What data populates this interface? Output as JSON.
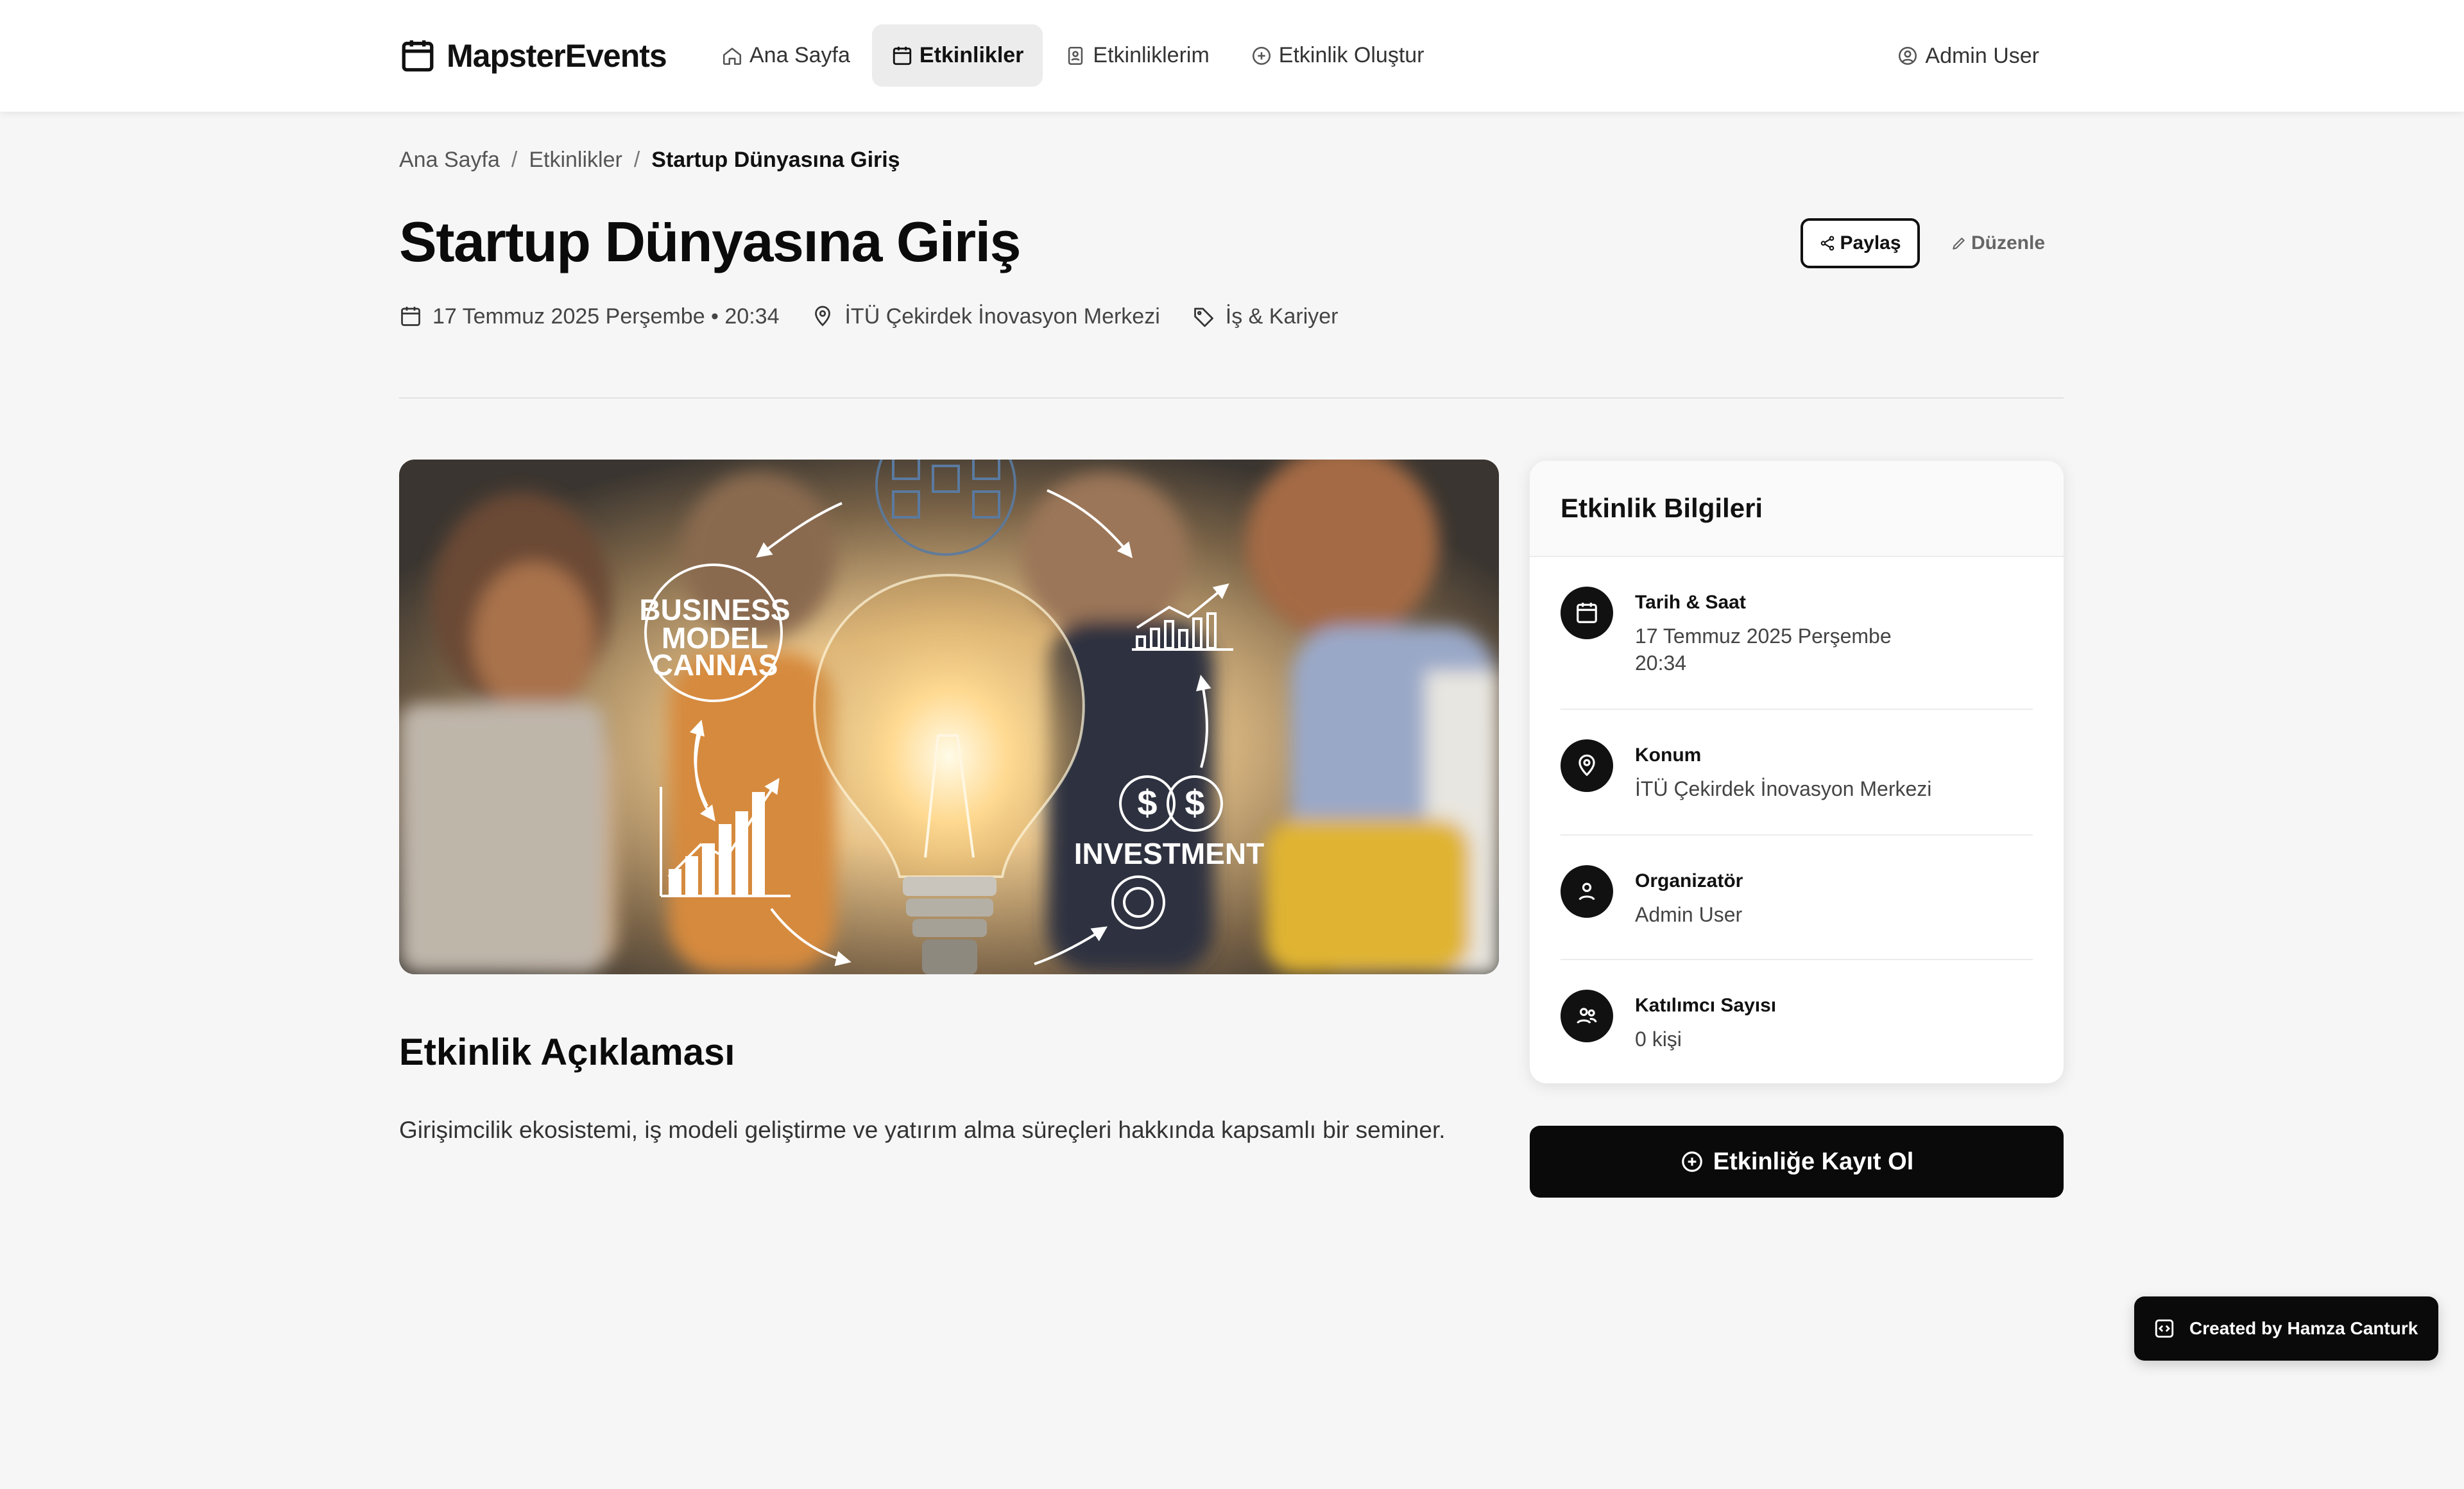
{
  "header": {
    "logo_text": "MapsterEvents",
    "nav": [
      {
        "label": "Ana Sayfa",
        "icon": "home-icon"
      },
      {
        "label": "Etkinlikler",
        "icon": "calendar-icon",
        "active": true
      },
      {
        "label": "Etkinliklerim",
        "icon": "badge-icon"
      },
      {
        "label": "Etkinlik Oluştur",
        "icon": "plus-circle-icon"
      }
    ],
    "user_label": "Admin User"
  },
  "breadcrumb": {
    "home": "Ana Sayfa",
    "section": "Etkinlikler",
    "current": "Startup Dünyasına Giriş",
    "separator": "/"
  },
  "event": {
    "title": "Startup Dünyasına Giriş",
    "date_time": "17 Temmuz 2025 Perşembe • 20:34",
    "location": "İTÜ Çekirdek İnovasyon Merkezi",
    "category": "İş & Kariyer",
    "share_label": "Paylaş",
    "edit_label": "Düzenle"
  },
  "hero_image": {
    "text_business": "BUSINESS",
    "text_model": "MODEL",
    "text_canvas": "CANNAS",
    "text_investment": "INVESTMENT"
  },
  "description": {
    "title": "Etkinlik Açıklaması",
    "text": "Girişimcilik ekosistemi, iş modeli geliştirme ve yatırım alma süreçleri hakkında kapsamlı bir seminer."
  },
  "info_card": {
    "title": "Etkinlik Bilgileri",
    "date_label": "Tarih & Saat",
    "date_line1": "17 Temmuz 2025 Perşembe",
    "date_line2": "20:34",
    "location_label": "Konum",
    "location_value": "İTÜ Çekirdek İnovasyon Merkezi",
    "organizer_label": "Organizatör",
    "organizer_value": "Admin User",
    "attendees_label": "Katılımcı Sayısı",
    "attendees_value": "0 kişi"
  },
  "register_button": "Etkinliğe Kayıt Ol",
  "footer_badge": "Created by Hamza Canturk",
  "colors": {
    "primary": "#0a0a0a",
    "background": "#f6f6f6",
    "card": "#ffffff",
    "muted_text": "#444444"
  }
}
